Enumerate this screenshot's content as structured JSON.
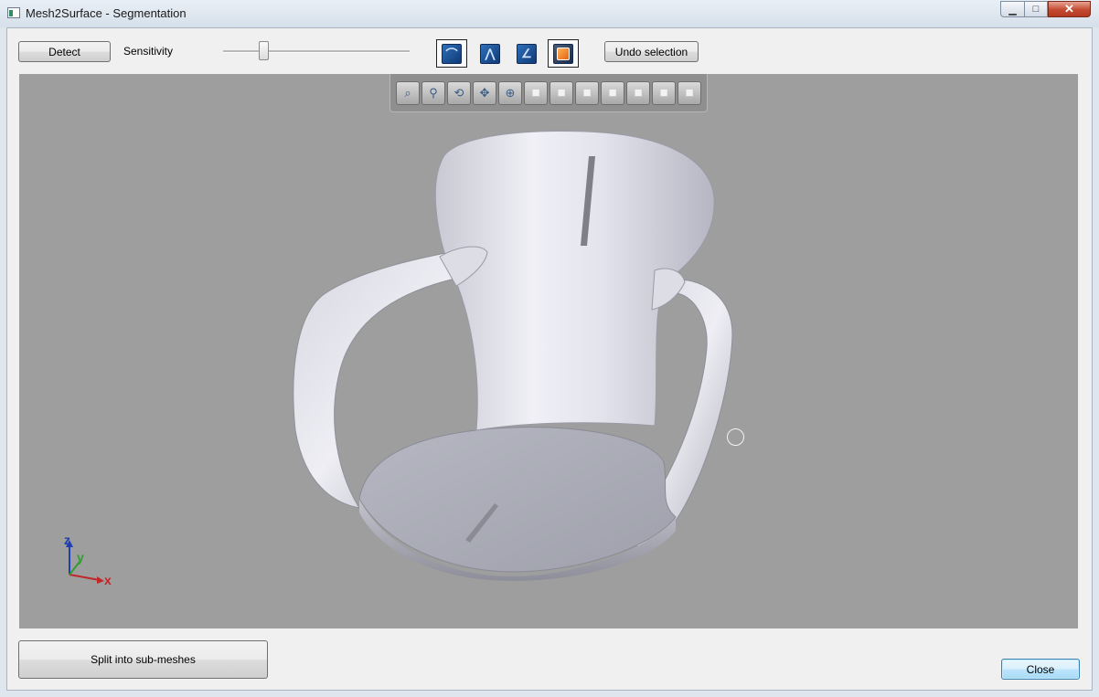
{
  "window": {
    "title": "Mesh2Surface - Segmentation",
    "controls": {
      "minimize": "▁",
      "maximize": "□",
      "close": "✕"
    }
  },
  "toolbar": {
    "detect_label": "Detect",
    "sensitivity_label": "Sensitivity",
    "sensitivity_value": 0.22,
    "tools": [
      {
        "icon": "curve-select-icon",
        "glyph": "⌒",
        "selected": true
      },
      {
        "icon": "edge-select-icon",
        "glyph": "⋀",
        "selected": false
      },
      {
        "icon": "angle-select-icon",
        "glyph": "∠",
        "selected": false
      },
      {
        "icon": "region-select-icon",
        "glyph": "",
        "selected": true
      }
    ],
    "undo_label": "Undo selection"
  },
  "view_toolbar": [
    {
      "name": "zoom-fit-icon",
      "glyph": "⌕"
    },
    {
      "name": "zoom-icon",
      "glyph": "⚲"
    },
    {
      "name": "rotate-icon",
      "glyph": "⟲"
    },
    {
      "name": "pan-icon",
      "glyph": "✥"
    },
    {
      "name": "zoom-selection-icon",
      "glyph": "⊕"
    },
    {
      "name": "view-front-icon",
      "glyph": "■"
    },
    {
      "name": "view-back-icon",
      "glyph": "■"
    },
    {
      "name": "view-left-icon",
      "glyph": "■"
    },
    {
      "name": "view-right-icon",
      "glyph": "■"
    },
    {
      "name": "view-top-icon",
      "glyph": "■"
    },
    {
      "name": "view-bottom-icon",
      "glyph": "■"
    },
    {
      "name": "view-iso-icon",
      "glyph": "■"
    }
  ],
  "axes": {
    "x": "x",
    "y": "y",
    "z": "z"
  },
  "colors": {
    "viewport_bg": "#9e9e9e",
    "axis_x": "#c0282a",
    "axis_y": "#2f9e2f",
    "axis_z": "#1f3fb0"
  },
  "bottom": {
    "split_label": "Split into sub-meshes",
    "close_label": "Close"
  }
}
